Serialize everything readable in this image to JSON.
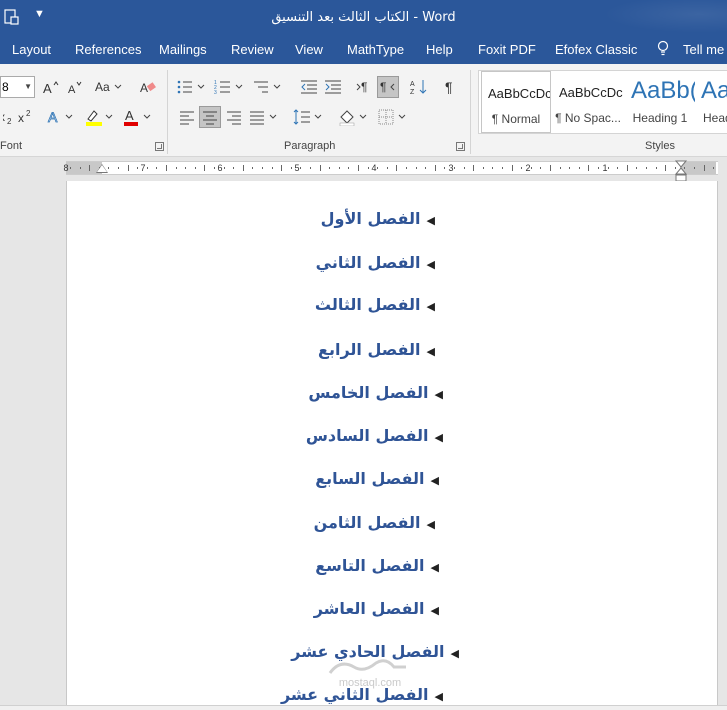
{
  "titlebar": {
    "title": "الكتاب الثالث بعد التنسيق  -  Word",
    "bg": "#2b579a"
  },
  "tabs": [
    "Layout",
    "References",
    "Mailings",
    "Review",
    "View",
    "MathType",
    "Help",
    "Foxit PDF",
    "Efofex Classic",
    "Tell me w"
  ],
  "ribbon": {
    "font_size_value": "8",
    "font_group_label": "Font",
    "paragraph_group_label": "Paragraph",
    "styles_group_label": "Styles",
    "styles": [
      {
        "sample": "AaBbCcDc",
        "name": "¶ Normal"
      },
      {
        "sample": "AaBbCcDc",
        "name": "¶ No Spac..."
      },
      {
        "sample": "AaBb(",
        "name": "Heading 1"
      },
      {
        "sample": "AaB",
        "name": "Head"
      }
    ]
  },
  "ruler": {
    "labels": [
      "8",
      "7",
      "6",
      "5",
      "4",
      "3",
      "2",
      "1"
    ]
  },
  "document": {
    "chapters": [
      "الفصل الأول",
      "الفصل الثاني",
      "الفصل الثالث",
      "الفصل الرابع",
      "الفصل الخامس",
      "الفصل السادس",
      "الفصل السابع",
      "الفصل الثامن",
      "الفصل التاسع",
      "الفصل العاشر",
      "الفصل الحادي عشر",
      "الفصل الثاني عشر"
    ],
    "heading_color": "#2f5496"
  },
  "watermark": {
    "text": "mostaql.com"
  }
}
